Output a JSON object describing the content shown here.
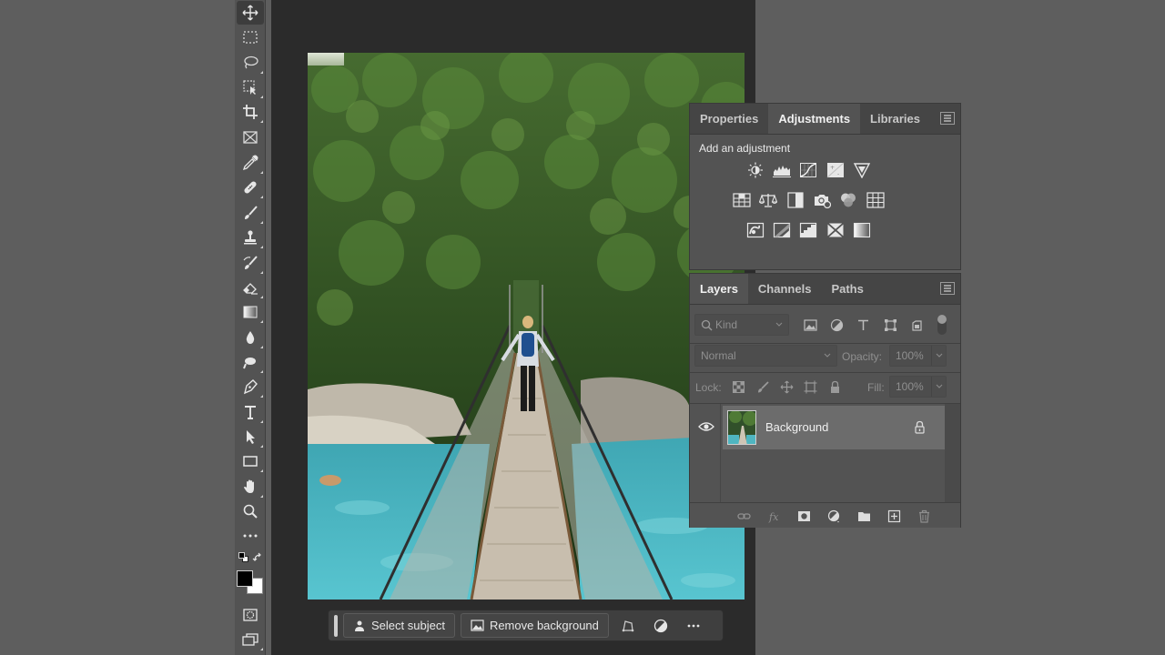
{
  "tools": [
    {
      "name": "move-tool",
      "icon": "move-icon"
    },
    {
      "name": "marquee-tool",
      "icon": "marquee-icon"
    },
    {
      "name": "lasso-tool",
      "icon": "lasso-icon"
    },
    {
      "name": "object-select-tool",
      "icon": "object-select-icon"
    },
    {
      "name": "crop-tool",
      "icon": "crop-icon"
    },
    {
      "name": "frame-tool",
      "icon": "frame-icon"
    },
    {
      "name": "eyedropper-tool",
      "icon": "eyedropper-icon"
    },
    {
      "name": "healing-brush-tool",
      "icon": "bandage-icon"
    },
    {
      "name": "brush-tool",
      "icon": "brush-icon"
    },
    {
      "name": "clone-stamp-tool",
      "icon": "stamp-icon"
    },
    {
      "name": "history-brush-tool",
      "icon": "history-brush-icon"
    },
    {
      "name": "eraser-tool",
      "icon": "eraser-icon"
    },
    {
      "name": "gradient-tool",
      "icon": "gradient-icon"
    },
    {
      "name": "blur-tool",
      "icon": "drop-icon"
    },
    {
      "name": "dodge-tool",
      "icon": "dodge-icon"
    },
    {
      "name": "pen-tool",
      "icon": "pen-icon"
    },
    {
      "name": "type-tool",
      "icon": "type-icon"
    },
    {
      "name": "path-select-tool",
      "icon": "arrow-icon"
    },
    {
      "name": "rectangle-tool",
      "icon": "rectangle-icon"
    },
    {
      "name": "hand-tool",
      "icon": "hand-icon"
    },
    {
      "name": "zoom-tool",
      "icon": "zoom-icon"
    },
    {
      "name": "more-tools",
      "icon": "ellipsis-icon"
    }
  ],
  "colors": {
    "foreground": "#000000",
    "background": "#ffffff",
    "accent": "#1473e6"
  },
  "taskbar": {
    "select_subject": "Select subject",
    "remove_background": "Remove background"
  },
  "adjustments_panel": {
    "tabs": [
      "Properties",
      "Adjustments",
      "Libraries"
    ],
    "active_tab": "Adjustments",
    "heading": "Add an adjustment",
    "icons_row1": [
      "brightness-contrast-icon",
      "levels-icon",
      "curves-icon",
      "exposure-icon",
      "vibrance-icon"
    ],
    "icons_row2": [
      "hue-saturation-icon",
      "color-balance-icon",
      "black-white-icon",
      "photo-filter-icon",
      "channel-mixer-icon",
      "color-lookup-icon"
    ],
    "icons_row3": [
      "invert-icon",
      "posterize-icon",
      "threshold-icon",
      "selective-color-icon",
      "gradient-map-icon"
    ]
  },
  "layers_panel": {
    "tabs": [
      "Layers",
      "Channels",
      "Paths"
    ],
    "active_tab": "Layers",
    "filter_placeholder": "Kind",
    "blend_mode": "Normal",
    "opacity_label": "Opacity:",
    "opacity_value": "100%",
    "lock_label": "Lock:",
    "fill_label": "Fill:",
    "fill_value": "100%",
    "layers": [
      {
        "name": "Background",
        "visible": true,
        "locked": true
      }
    ]
  }
}
